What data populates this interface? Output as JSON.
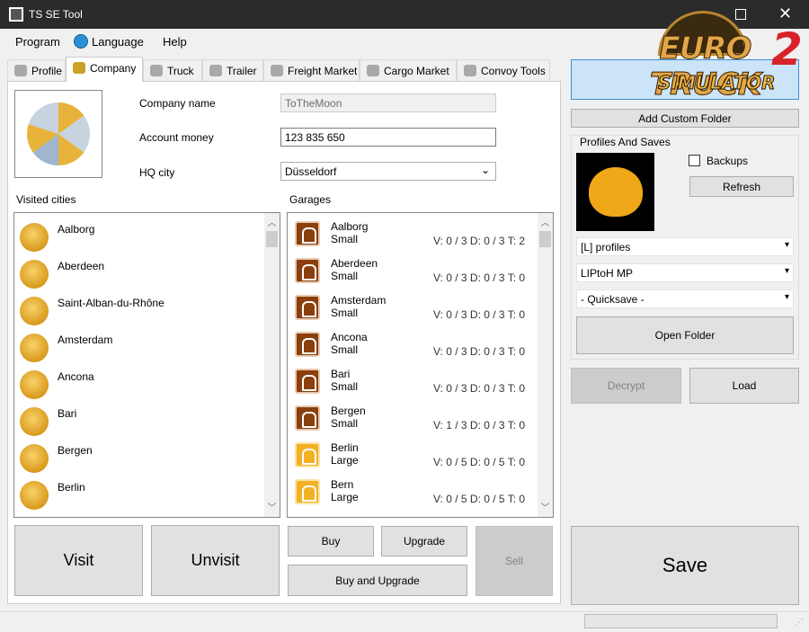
{
  "window": {
    "title": "TS SE Tool",
    "maximize_icon": "maximize-icon",
    "close_icon": "close-icon"
  },
  "menu": {
    "program": "Program",
    "language": "Language",
    "help": "Help"
  },
  "tabs": [
    {
      "label": "Profile"
    },
    {
      "label": "Company"
    },
    {
      "label": "Truck"
    },
    {
      "label": "Trailer"
    },
    {
      "label": "Freight Market"
    },
    {
      "label": "Cargo Market"
    },
    {
      "label": "Convoy Tools"
    }
  ],
  "company": {
    "name_label": "Company name",
    "name_value": "ToTheMoon",
    "money_label": "Account money",
    "money_value": "123 835 650",
    "hq_label": "HQ city",
    "hq_value": "Düsseldorf"
  },
  "visited": {
    "label": "Visited cities",
    "items": [
      "Aalborg",
      "Aberdeen",
      "Saint-Alban-du-Rhône",
      "Amsterdam",
      "Ancona",
      "Bari",
      "Bergen",
      "Berlin"
    ]
  },
  "garages": {
    "label": "Garages",
    "items": [
      {
        "city": "Aalborg",
        "size": "Small",
        "stats": "V: 0 / 3 D: 0 / 3 T: 2"
      },
      {
        "city": "Aberdeen",
        "size": "Small",
        "stats": "V: 0 / 3 D: 0 / 3 T: 0"
      },
      {
        "city": "Amsterdam",
        "size": "Small",
        "stats": "V: 0 / 3 D: 0 / 3 T: 0"
      },
      {
        "city": "Ancona",
        "size": "Small",
        "stats": "V: 0 / 3 D: 0 / 3 T: 0"
      },
      {
        "city": "Bari",
        "size": "Small",
        "stats": "V: 0 / 3 D: 0 / 3 T: 0"
      },
      {
        "city": "Bergen",
        "size": "Small",
        "stats": "V: 1 / 3 D: 0 / 3 T: 0"
      },
      {
        "city": "Berlin",
        "size": "Large",
        "stats": "V: 0 / 5 D: 0 / 5 T: 0"
      },
      {
        "city": "Bern",
        "size": "Large",
        "stats": "V: 0 / 5 D: 0 / 5 T: 0"
      }
    ]
  },
  "buttons": {
    "visit": "Visit",
    "unvisit": "Unvisit",
    "buy": "Buy",
    "upgrade": "Upgrade",
    "buy_upgrade": "Buy and Upgrade",
    "sell": "Sell",
    "add_folder": "Add Custom Folder",
    "refresh": "Refresh",
    "open_folder": "Open Folder",
    "decrypt": "Decrypt",
    "load": "Load",
    "save": "Save"
  },
  "profiles": {
    "group_label": "Profiles And Saves",
    "backups_label": "Backups",
    "backups_checked": false,
    "folder": "[L] profiles",
    "profile": "LIPtoH MP",
    "save": "- Quicksave -"
  },
  "logo": {
    "text_top": "EURO TRUCK",
    "text_num": "2",
    "text_bottom": "SIMULATOR"
  },
  "colors": {
    "small_garage": "#8a3f0c",
    "large_garage": "#f4b025",
    "titlebar": "#2b2b2b"
  }
}
